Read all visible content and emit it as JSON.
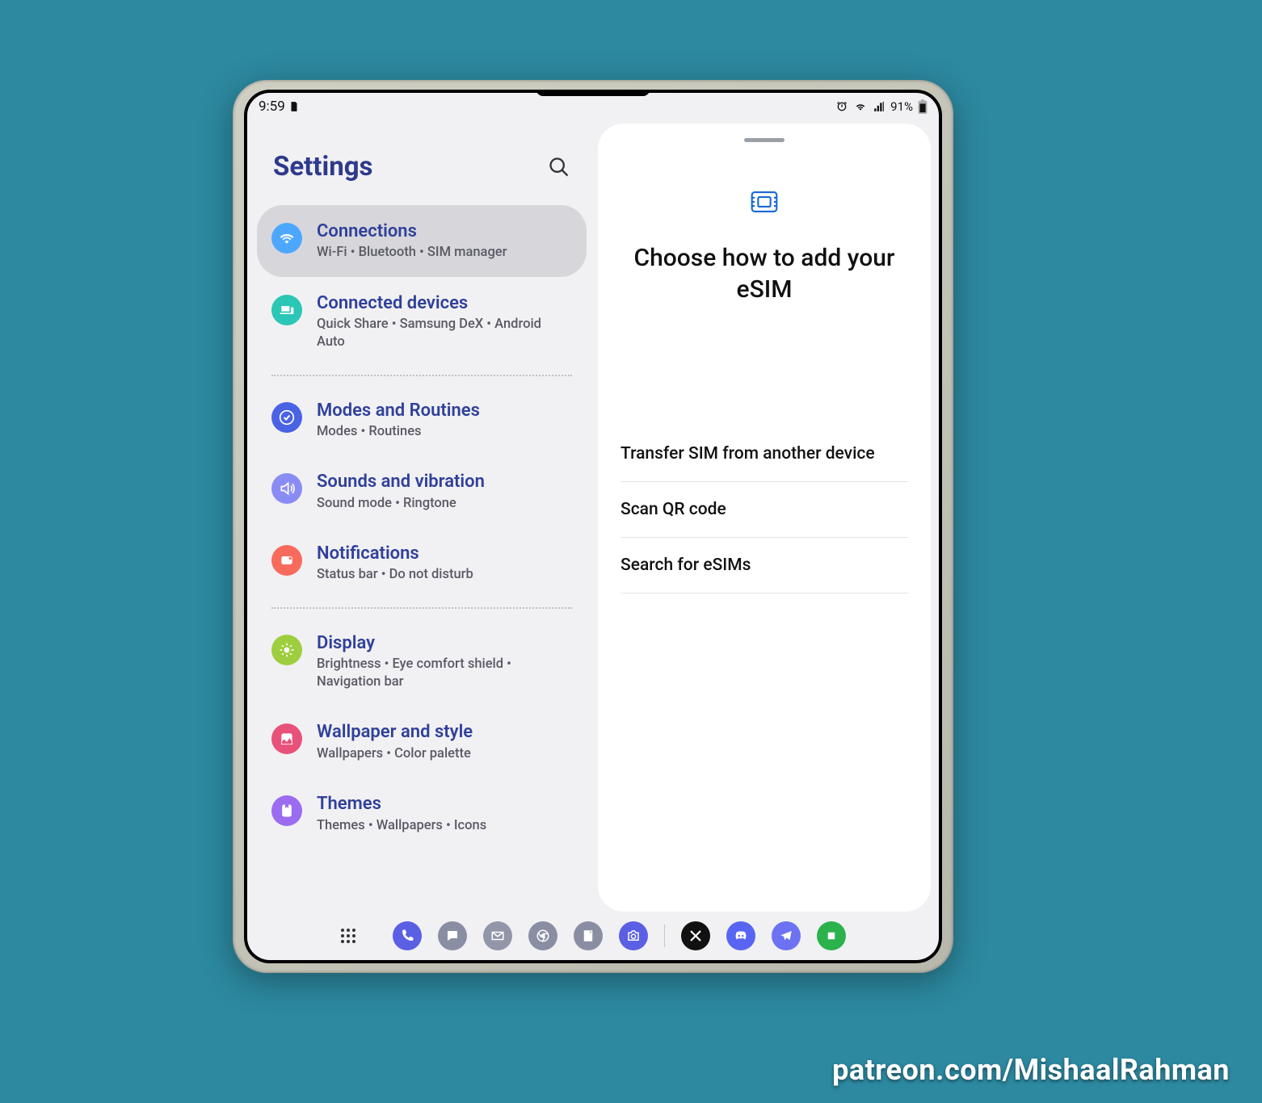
{
  "status": {
    "time": "9:59",
    "battery_pct": "91%"
  },
  "left": {
    "title": "Settings",
    "items": [
      {
        "title": "Connections",
        "sub": "Wi-Fi  •  Bluetooth  •  SIM manager",
        "color": "#4DA7FF",
        "icon": "wifi",
        "selected": true
      },
      {
        "title": "Connected devices",
        "sub": "Quick Share  •  Samsung DeX  •  Android Auto",
        "color": "#2BC6B5",
        "icon": "devices"
      },
      {
        "divider": true
      },
      {
        "title": "Modes and Routines",
        "sub": "Modes  •  Routines",
        "color": "#4A63E4",
        "icon": "check"
      },
      {
        "title": "Sounds and vibration",
        "sub": "Sound mode  •  Ringtone",
        "color": "#8A8CF5",
        "icon": "sound"
      },
      {
        "title": "Notifications",
        "sub": "Status bar  •  Do not disturb",
        "color": "#F76B5C",
        "icon": "notif"
      },
      {
        "divider": true
      },
      {
        "title": "Display",
        "sub": "Brightness  •  Eye comfort shield  •  Navigation bar",
        "color": "#9ECE3F",
        "icon": "display"
      },
      {
        "title": "Wallpaper and style",
        "sub": "Wallpapers  •  Color palette",
        "color": "#E85179",
        "icon": "wallpaper"
      },
      {
        "title": "Themes",
        "sub": "Themes  •  Wallpapers  •  Icons",
        "color": "#9B6CF0",
        "icon": "themes"
      }
    ]
  },
  "panel": {
    "title": "Choose how to add your eSIM",
    "options": [
      "Transfer SIM from another device",
      "Scan QR code",
      "Search for eSIMs"
    ]
  },
  "dock": {
    "left": [
      {
        "name": "app-drawer",
        "color": ""
      },
      {
        "name": "phone",
        "color": "#5B5FE3"
      },
      {
        "name": "messages",
        "color": "#8A8EA3"
      },
      {
        "name": "gmail",
        "color": "#9296A8"
      },
      {
        "name": "chrome",
        "color": "#8A8EA3"
      },
      {
        "name": "notes",
        "color": "#8A8EA3"
      },
      {
        "name": "camera",
        "color": "#5B5FE3"
      }
    ],
    "right": [
      {
        "name": "x",
        "color": "#111111"
      },
      {
        "name": "discord",
        "color": "#5865F2"
      },
      {
        "name": "telegram",
        "color": "#6C72F2"
      },
      {
        "name": "feedly",
        "color": "#2BB24C"
      }
    ]
  },
  "watermark": "patreon.com/MishaalRahman"
}
